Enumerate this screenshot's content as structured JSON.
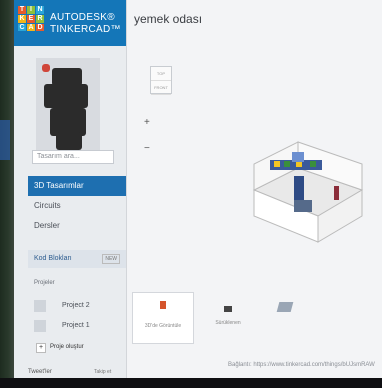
{
  "sidebar": {
    "brand_line1": "AUTODESK®",
    "brand_line2": "TINKERCAD™",
    "logo_letters": [
      "T",
      "I",
      "N",
      "K",
      "E",
      "R",
      "C",
      "A",
      "D"
    ],
    "search_placeholder": "Tasarım ara...",
    "nav": {
      "designs": "3D Tasarımlar",
      "circuits": "Circuits",
      "lessons": "Dersler"
    },
    "code_blocks": "Kod Blokları",
    "new_badge": "NEW",
    "projects_header": "Projeler",
    "projects": [
      "Project 2",
      "Project 1"
    ],
    "create_project": "Proje oluştur",
    "tweet": "Tweet'ler",
    "follow": "Takip et"
  },
  "main": {
    "title": "yemek odası",
    "viewcube": {
      "top": "TOP",
      "front": "FRONT"
    },
    "zoom_in": "+",
    "zoom_out": "−",
    "thumbnails": [
      {
        "caption": "3D'de Görüntüle"
      },
      {
        "caption": "Sürüklenen"
      },
      {
        "caption": ""
      }
    ],
    "share_label": "Bağlantı:",
    "share_url": "https://www.tinkercad.com/things/bUJsmRAW"
  }
}
